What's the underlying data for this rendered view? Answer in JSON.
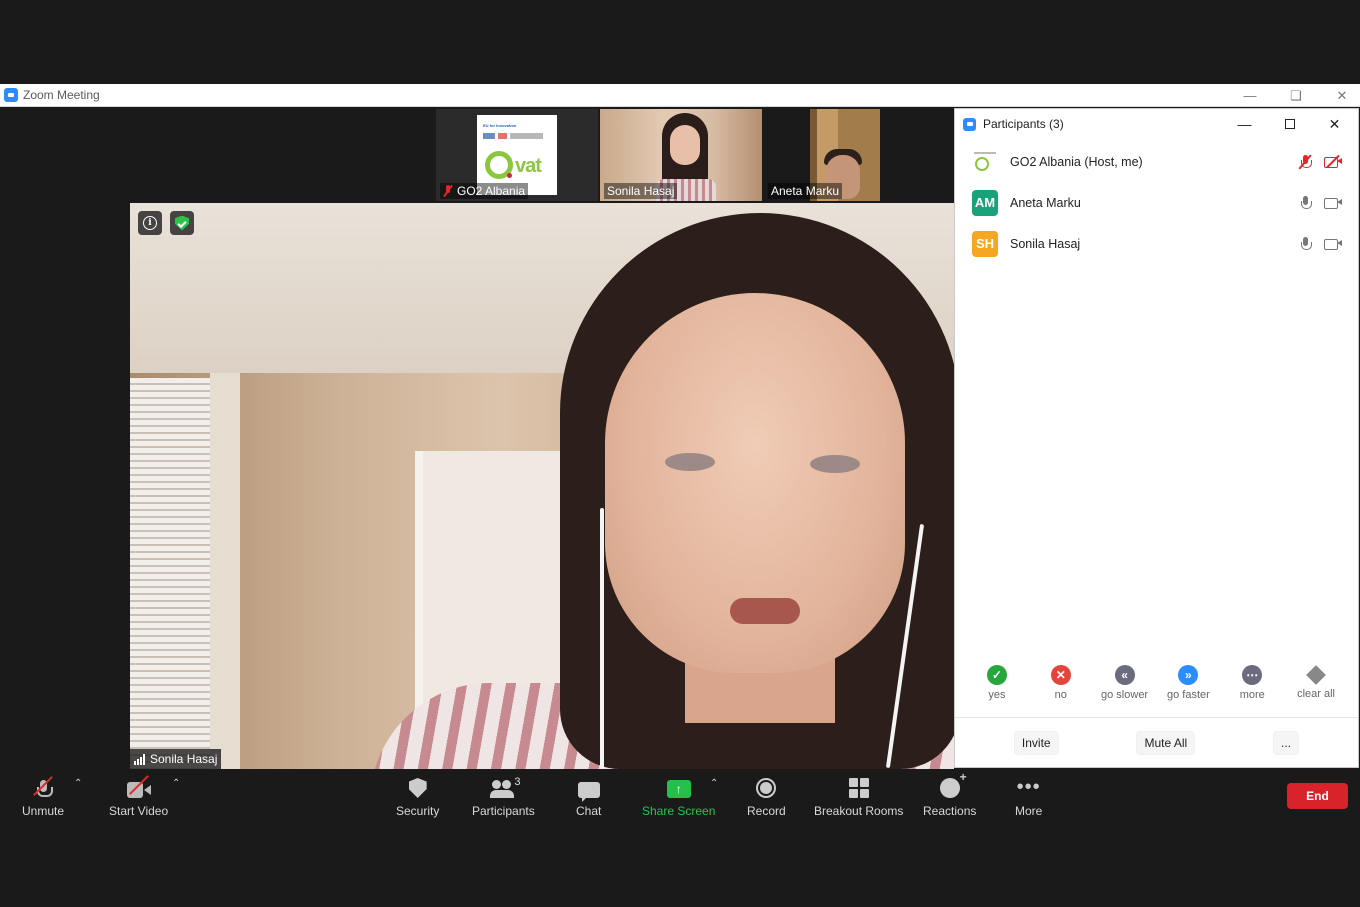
{
  "window": {
    "title": "Zoom Meeting"
  },
  "thumbnails": [
    {
      "name": "GO2 Albania",
      "muted": true,
      "logo_text": "EU for Innovation",
      "logo_word": "vat"
    },
    {
      "name": "Sonila Hasaj",
      "active": true
    },
    {
      "name": "Aneta Marku"
    }
  ],
  "main_video": {
    "speaker": "Sonila Hasaj"
  },
  "participants_panel": {
    "title": "Participants (3)",
    "participants": [
      {
        "name": "GO2 Albania (Host, me)",
        "initials": "",
        "avatar_color": "#ffffff",
        "mic": "muted",
        "video": "off"
      },
      {
        "name": "Aneta Marku",
        "initials": "AM",
        "avatar_color": "#1aa37a",
        "mic": "on",
        "video": "on"
      },
      {
        "name": "Sonila Hasaj",
        "initials": "SH",
        "avatar_color": "#f5a623",
        "mic": "on",
        "video": "on"
      }
    ],
    "feedback": [
      {
        "label": "yes",
        "icon": "check-icon",
        "color": "#26a63b"
      },
      {
        "label": "no",
        "icon": "x-icon",
        "color": "#e5443b"
      },
      {
        "label": "go slower",
        "icon": "rewind-icon",
        "color": "#6b6b80"
      },
      {
        "label": "go faster",
        "icon": "fast-forward-icon",
        "color": "#2d8cff"
      },
      {
        "label": "more",
        "icon": "more-icon",
        "color": "#6b6b80"
      },
      {
        "label": "clear all",
        "icon": "eraser-icon",
        "color": "#888888"
      }
    ],
    "buttons": {
      "invite": "Invite",
      "mute_all": "Mute All",
      "more": "..."
    }
  },
  "toolbar": {
    "unmute": "Unmute",
    "start_video": "Start Video",
    "security": "Security",
    "participants": "Participants",
    "participants_count": "3",
    "chat": "Chat",
    "share_screen": "Share Screen",
    "record": "Record",
    "breakout_rooms": "Breakout Rooms",
    "reactions": "Reactions",
    "more": "More",
    "end": "End"
  }
}
